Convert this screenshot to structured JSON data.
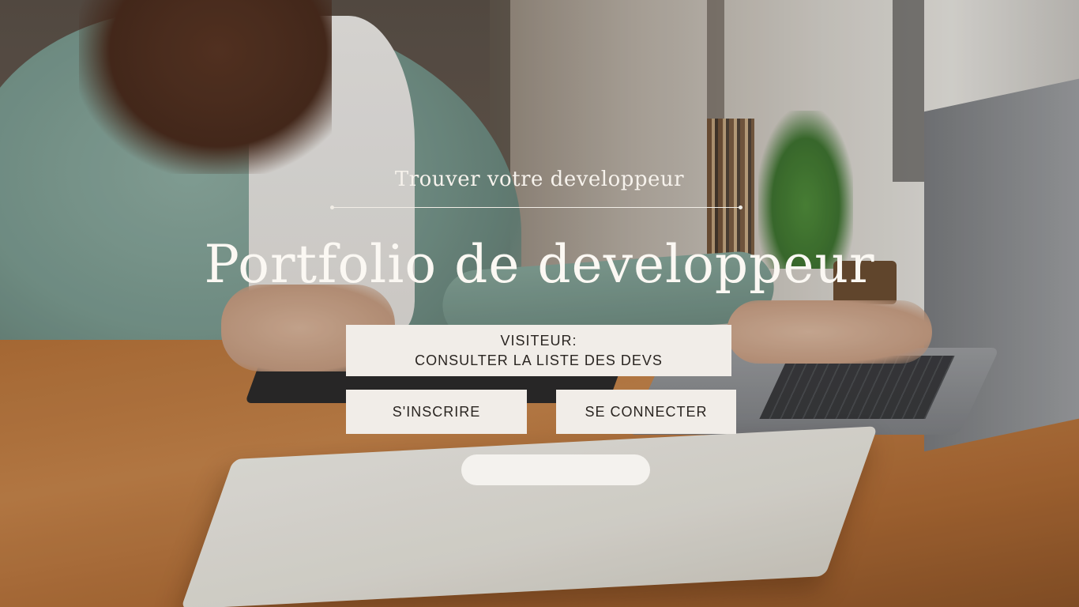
{
  "hero": {
    "subtitle": "Trouver votre developpeur",
    "title": "Portfolio de developpeur"
  },
  "actions": {
    "visitor_line1": "VISITEUR:",
    "visitor_line2": "CONSULTER LA LISTE DES DEVS",
    "signup_label": "S'INSCRIRE",
    "login_label": "SE CONNECTER"
  },
  "colors": {
    "button_bg": "#f1ede8",
    "button_text": "#2a2521",
    "hero_text": "#fbf8f3"
  }
}
